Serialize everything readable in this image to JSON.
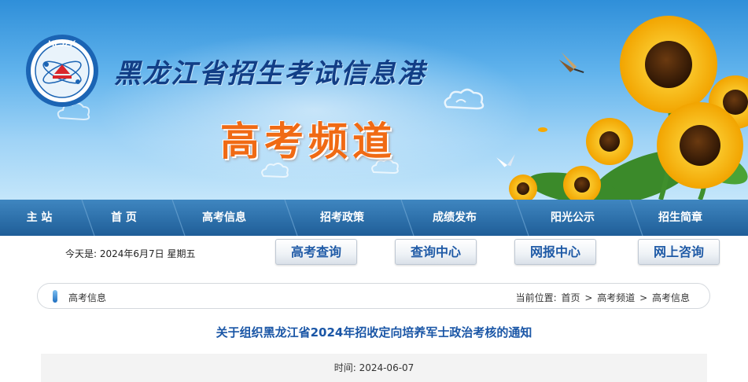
{
  "banner": {
    "logo_text": "HLJZK",
    "logo_ring_text": "黑龙江招生考试信息港",
    "site_title": "黑龙江省招生考试信息港",
    "channel_title": "高考频道"
  },
  "nav": {
    "items": [
      {
        "label": "主 站"
      },
      {
        "label": "首 页"
      },
      {
        "label": "高考信息"
      },
      {
        "label": "招考政策"
      },
      {
        "label": "成绩发布"
      },
      {
        "label": "阳光公示"
      },
      {
        "label": "招生简章"
      }
    ]
  },
  "infobar": {
    "date_label": "今天是:",
    "date_value": "2024年6月7日 星期五",
    "buttons": [
      {
        "label": "高考查询"
      },
      {
        "label": "查询中心"
      },
      {
        "label": "网报中心"
      },
      {
        "label": "网上咨询"
      }
    ]
  },
  "breadcrumb": {
    "section": "高考信息",
    "position_label": "当前位置:",
    "path": [
      "首页",
      "高考频道",
      "高考信息"
    ],
    "separator": ">"
  },
  "article": {
    "title": "关于组织黑龙江省2024年招收定向培养军士政治考核的通知",
    "time_label": "时间:",
    "time_value": "2024-06-07"
  }
}
